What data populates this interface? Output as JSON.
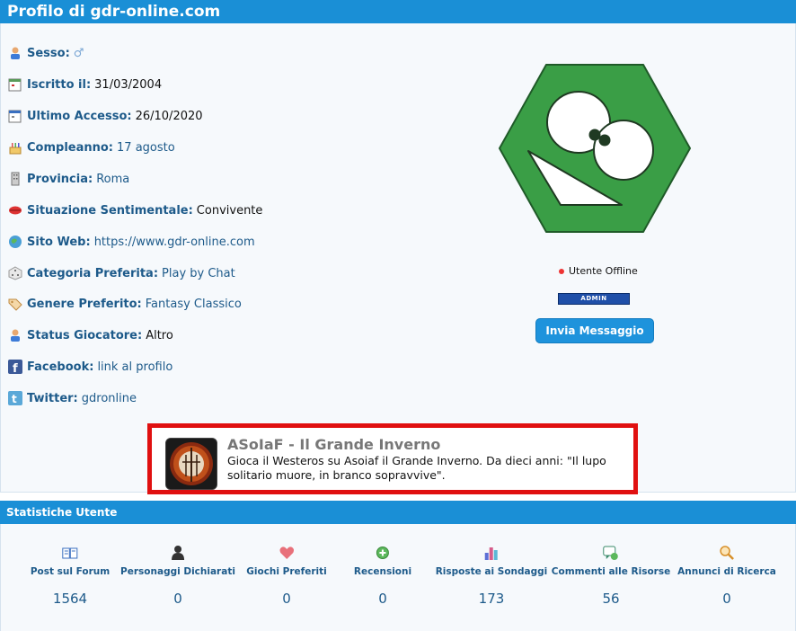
{
  "header": {
    "title": "Profilo di gdr-online.com"
  },
  "profile": {
    "fields": [
      {
        "label": "Sesso:",
        "value": "♂",
        "link": true
      },
      {
        "label": "Iscritto il:",
        "value": "31/03/2004",
        "link": false
      },
      {
        "label": "Ultimo Accesso:",
        "value": "26/10/2020",
        "link": false
      },
      {
        "label": "Compleanno:",
        "value": "17 agosto",
        "link": true
      },
      {
        "label": "Provincia:",
        "value": "Roma",
        "link": true
      },
      {
        "label": "Situazione Sentimentale:",
        "value": "Convivente",
        "link": false
      },
      {
        "label": "Sito Web:",
        "value": "https://www.gdr-online.com",
        "link": true
      },
      {
        "label": "Categoria Preferita:",
        "value": "Play by Chat",
        "link": true
      },
      {
        "label": "Genere Preferito:",
        "value": "Fantasy Classico",
        "link": true
      },
      {
        "label": "Status Giocatore:",
        "value": "Altro",
        "link": false
      },
      {
        "label": "Facebook:",
        "value": "link al profilo",
        "link": true
      },
      {
        "label": "Twitter:",
        "value": "gdronline",
        "link": true
      }
    ],
    "status": "Utente Offline",
    "badge": "ADMIN",
    "message_button": "Invia Messaggio"
  },
  "promo": {
    "title": "ASoIaF - Il Grande Inverno",
    "description": "Gioca il Westeros su Asoiaf il Grande Inverno. Da dieci anni: \"Il lupo solitario muore, in branco sopravvive\"."
  },
  "stats": {
    "title": "Statistiche Utente",
    "items": [
      {
        "label": "Post sul Forum",
        "value": "1564",
        "icon": "book-icon"
      },
      {
        "label": "Personaggi Dichiarati",
        "value": "0",
        "icon": "person-icon"
      },
      {
        "label": "Giochi Preferiti",
        "value": "0",
        "icon": "heart-icon"
      },
      {
        "label": "Recensioni",
        "value": "0",
        "icon": "plus-circle-icon"
      },
      {
        "label": "Risposte ai Sondaggi",
        "value": "173",
        "icon": "bar-chart-icon"
      },
      {
        "label": "Commenti alle Risorse",
        "value": "56",
        "icon": "comment-icon"
      },
      {
        "label": "Annunci di Ricerca",
        "value": "0",
        "icon": "magnifier-icon"
      }
    ]
  },
  "colors": {
    "accent": "#1a8fd6",
    "label": "#1d5a8a",
    "highlight": "#e01010",
    "logo": "#3a9e46"
  }
}
